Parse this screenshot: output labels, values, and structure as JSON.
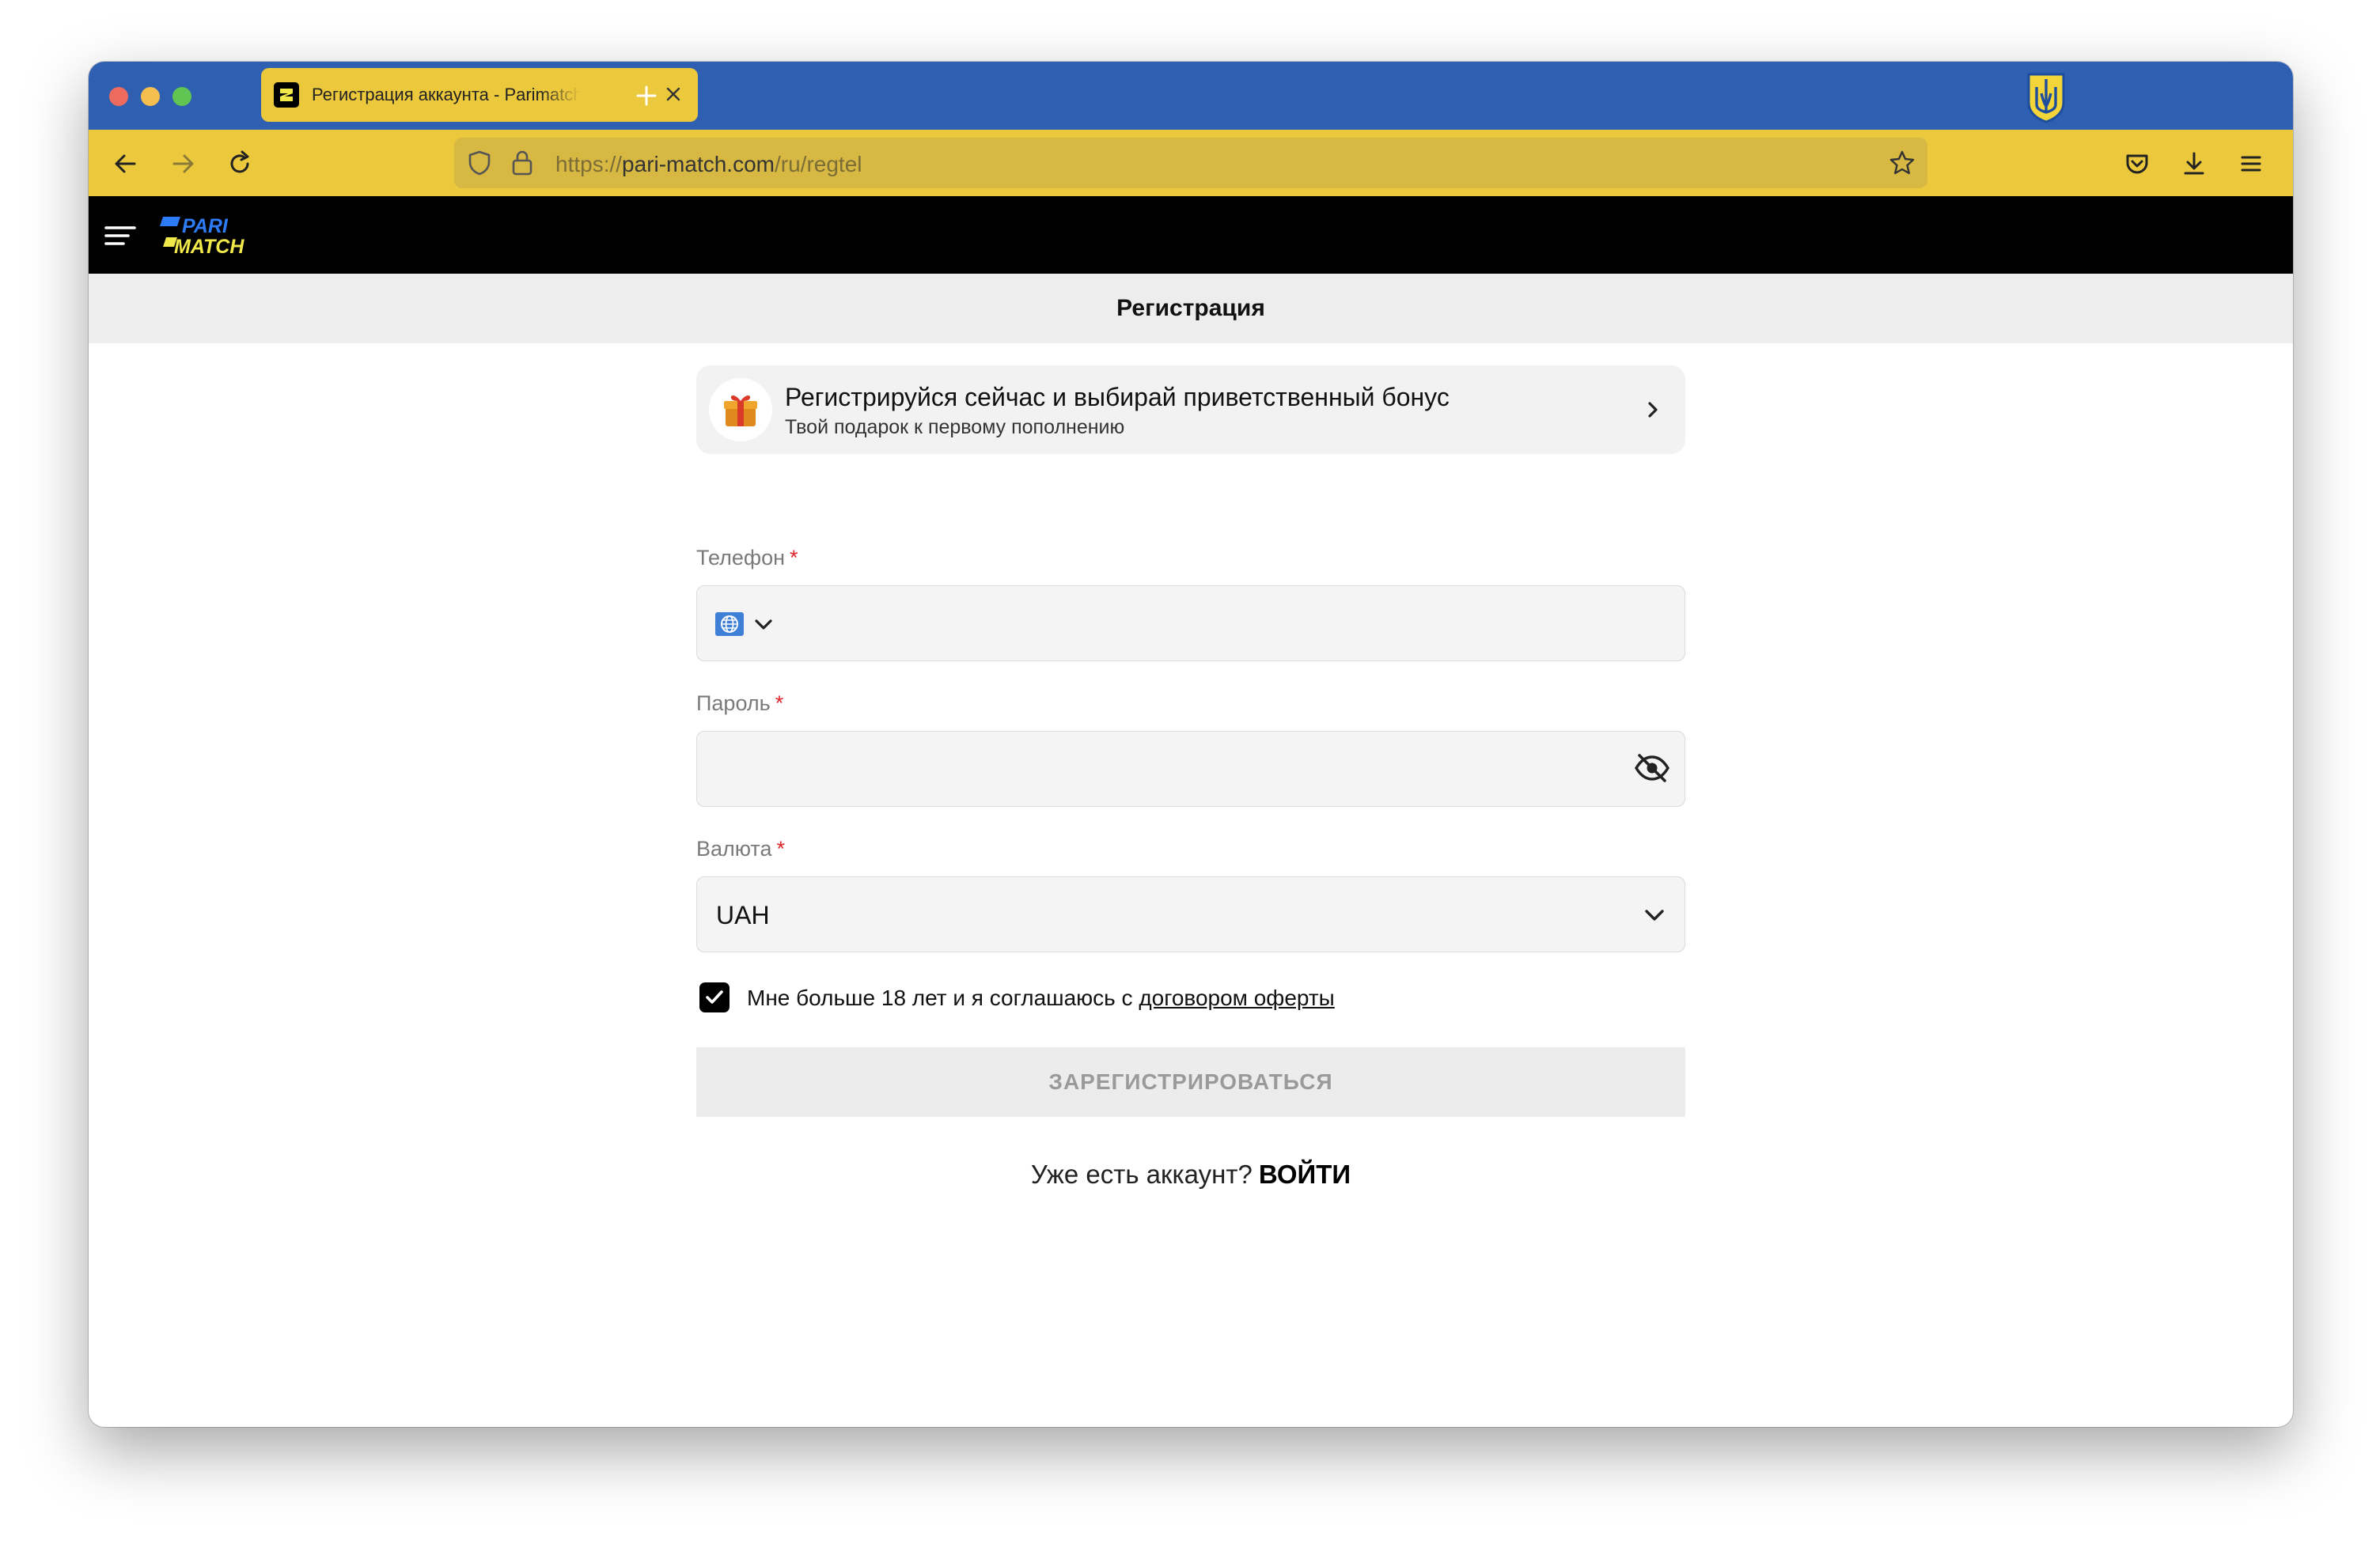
{
  "browser": {
    "tab_title": "Регистрация аккаунта - Parimatch",
    "url_prefix": "https://",
    "url_host": "pari-match.com",
    "url_path": "/ru/regtel",
    "theme_colors": {
      "tabbar": "#2e5fb0",
      "toolbar": "#ecc93c"
    },
    "icons": [
      "back-icon",
      "forward-icon",
      "reload-icon",
      "shield-icon",
      "lock-icon",
      "star-icon",
      "pocket-icon",
      "download-icon",
      "menu-icon",
      "ukraine-crest-icon"
    ]
  },
  "site": {
    "logo_line1": "PARI",
    "logo_line2": "MATCH",
    "brand_colors": {
      "header": "#000000",
      "logo_blue": "#2d7cf6",
      "logo_yellow": "#f1e84a"
    }
  },
  "page": {
    "title": "Регистрация"
  },
  "bonus_banner": {
    "title": "Регистрируйся сейчас и выбирай приветственный бонус",
    "subtitle": "Твой подарок к первому пополнению"
  },
  "form": {
    "phone_label": "Телефон",
    "password_label": "Пароль",
    "currency_label": "Валюта",
    "required_mark": "*",
    "phone_value": "",
    "password_value": "",
    "currency_value": "UAH",
    "agree_checked": true,
    "agree_text": "Мне больше 18 лет и я соглашаюсь с",
    "agree_link": "договором оферты",
    "submit_label": "ЗАРЕГИСТРИРОВАТЬСЯ",
    "have_account_text": "Уже есть аккаунт?",
    "login_link": "ВОЙТИ"
  }
}
